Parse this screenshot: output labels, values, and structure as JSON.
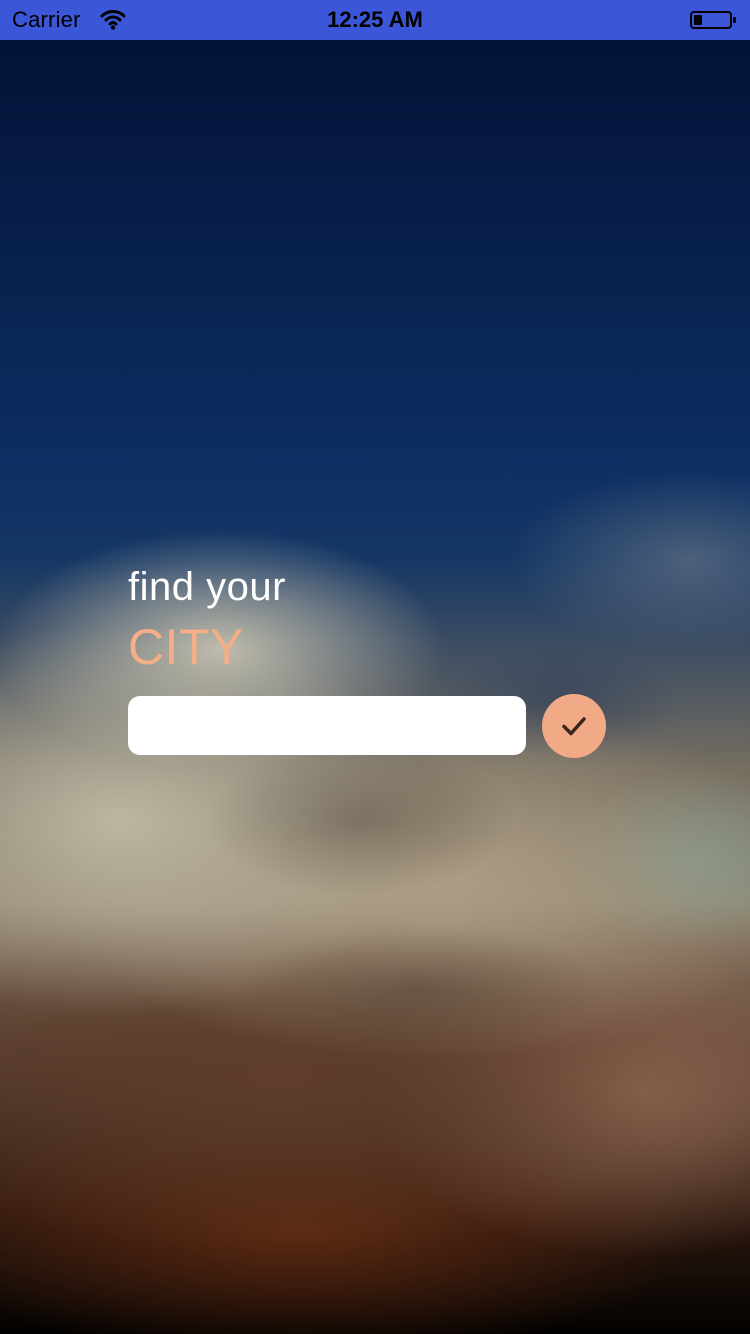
{
  "status_bar": {
    "carrier": "Carrier",
    "time": "12:25 AM",
    "background_color": "#3b56d6"
  },
  "search_form": {
    "title_line_1": "find your",
    "title_line_2": "CITY",
    "title_line_1_color": "#ffffff",
    "title_line_2_color": "#f4ae88",
    "input_value": "",
    "input_placeholder": "",
    "submit_icon": "checkmark-icon",
    "submit_button_color": "#f2aa86"
  },
  "icons": {
    "wifi": "wifi-icon",
    "battery": "battery-icon",
    "submit": "checkmark-icon"
  }
}
